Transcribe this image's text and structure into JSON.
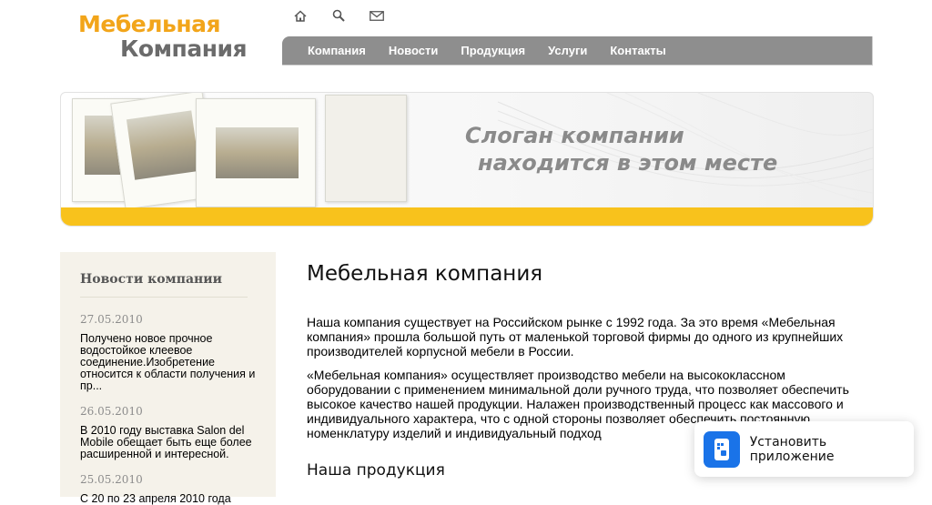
{
  "logo": {
    "line1": "Мебельная",
    "line2": "Компания"
  },
  "top_icons": [
    "home-icon",
    "search-icon",
    "mail-icon"
  ],
  "nav": {
    "items": [
      "Компания",
      "Новости",
      "Продукция",
      "Услуги",
      "Контакты"
    ]
  },
  "banner": {
    "slogan_line1": "Слоган компании",
    "slogan_line2": "находится в этом месте"
  },
  "sidebar": {
    "title": "Новости компании",
    "news": [
      {
        "date": "27.05.2010",
        "text": "Получено новое прочное водостойкое клеевое соединение.Изобретение относится к области получения и пр..."
      },
      {
        "date": "26.05.2010",
        "text": "В 2010 году выставка Salon del Mobile обещает быть еще более расширенной и интересной."
      },
      {
        "date": "25.05.2010",
        "text": "С 20 по 23 апреля 2010 года"
      }
    ]
  },
  "main": {
    "title": "Мебельная компания",
    "p1": "Наша компания существует на Российском рынке с 1992 года. За это время «Мебельная компания» прошла большой путь от маленькой торговой фирмы до одного из крупнейших производителей корпусной мебели в России.",
    "p2": "«Мебельная компания» осуществляет производство мебели на высококлассном оборудовании с применением минимальной доли ручного труда, что позволяет обеспечить высокое качество нашей продукции. Налажен производственный процесс как массового и индивидуального характера, что с одной стороны позволяет обеспечить постоянную номенклатуру изделий и индивидуальный подход",
    "subtitle": "Наша продукция"
  },
  "install": {
    "label": "Установить приложение"
  },
  "colors": {
    "accent": "#f2a51a",
    "nav_bg": "#8e8e8e",
    "stripe": "#f8c21c",
    "install_blue": "#1a73e8"
  }
}
